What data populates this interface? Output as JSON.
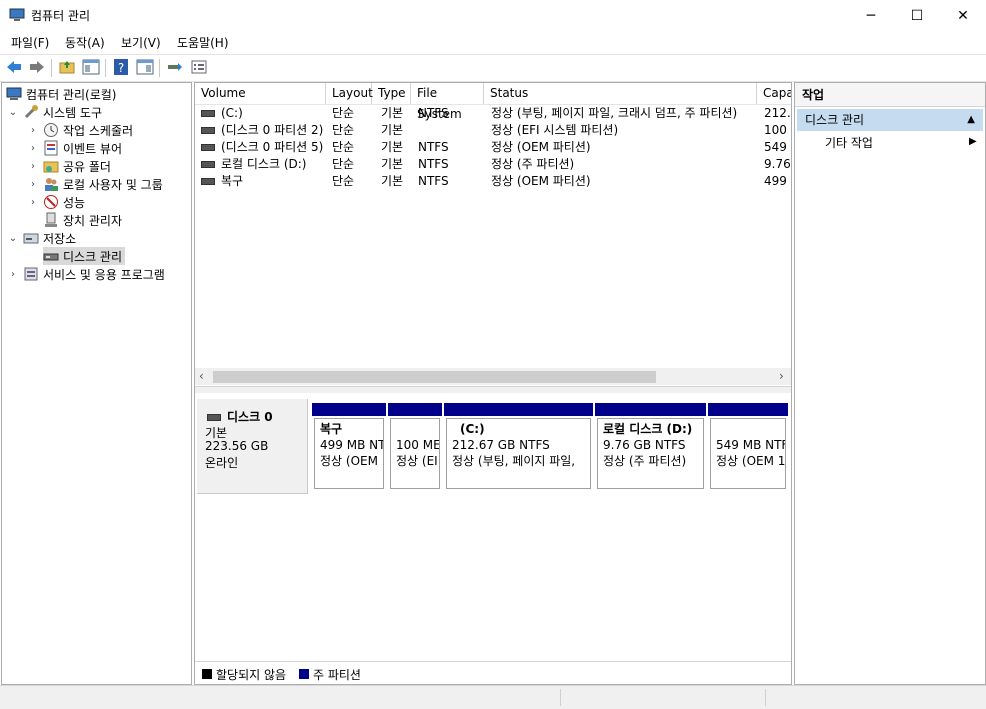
{
  "window": {
    "title": "컴퓨터 관리",
    "minimize": "─",
    "maximize": "☐",
    "close": "✕"
  },
  "menu": [
    "파일(F)",
    "동작(A)",
    "보기(V)",
    "도움말(H)"
  ],
  "tree": {
    "root": "컴퓨터 관리(로컬)",
    "system_tools": "시스템 도구",
    "task_scheduler": "작업 스케줄러",
    "event_viewer": "이벤트 뷰어",
    "shared_folders": "공유 폴더",
    "local_users": "로컬 사용자 및 그룹",
    "performance": "성능",
    "device_manager": "장치 관리자",
    "storage": "저장소",
    "disk_management": "디스크 관리",
    "services": "서비스 및 응용 프로그램"
  },
  "columns": [
    "Volume",
    "Layout",
    "Type",
    "File System",
    "Status",
    "Capa"
  ],
  "volumes": [
    {
      "name": "(C:)",
      "layout": "단순",
      "type": "기본",
      "fs": "NTFS",
      "status": "정상 (부팅, 페이지 파일, 크래시 덤프, 주 파티션)",
      "cap": "212.6"
    },
    {
      "name": "(디스크 0 파티션 2)",
      "layout": "단순",
      "type": "기본",
      "fs": "",
      "status": "정상 (EFI 시스템 파티션)",
      "cap": "100 I"
    },
    {
      "name": "(디스크 0 파티션 5)",
      "layout": "단순",
      "type": "기본",
      "fs": "NTFS",
      "status": "정상 (OEM 파티션)",
      "cap": "549 I"
    },
    {
      "name": "로컬 디스크 (D:)",
      "layout": "단순",
      "type": "기본",
      "fs": "NTFS",
      "status": "정상 (주 파티션)",
      "cap": "9.76"
    },
    {
      "name": "복구",
      "layout": "단순",
      "type": "기본",
      "fs": "NTFS",
      "status": "정상 (OEM 파티션)",
      "cap": "499 I"
    }
  ],
  "disk": {
    "name": "디스크 0",
    "type": "기본",
    "size": "223.56 GB",
    "state": "온라인",
    "partitions": [
      {
        "title": "복구",
        "size": "499 MB NT",
        "status": "정상 (OEM"
      },
      {
        "title": "",
        "size": "100 ME",
        "status": "정상 (EI"
      },
      {
        "title": "(C:)",
        "size": "212.67 GB NTFS",
        "status": "정상 (부팅, 페이지 파일,"
      },
      {
        "title": "로컬 디스크  (D:)",
        "size": "9.76 GB NTFS",
        "status": "정상 (주 파티션)"
      },
      {
        "title": "",
        "size": "549 MB NTF",
        "status": "정상 (OEM 1"
      }
    ]
  },
  "legend": {
    "unallocated": "할당되지 않음",
    "primary": "주 파티션"
  },
  "actions": {
    "title": "작업",
    "section": "디스크 관리",
    "more": "기타 작업"
  },
  "colors": {
    "primary_partition": "#00008b",
    "selection": "#c5dbef"
  }
}
